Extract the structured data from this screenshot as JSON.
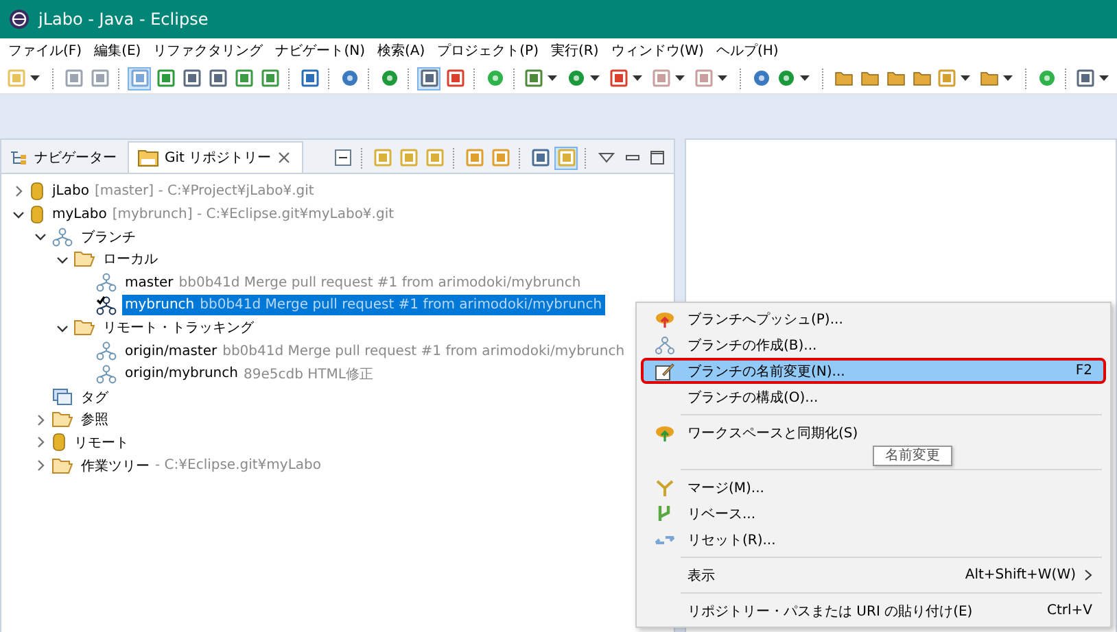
{
  "window": {
    "title": "jLabo - Java - Eclipse"
  },
  "menu_bar": [
    "ファイル(F)",
    "編集(E)",
    "リファクタリング",
    "ナビゲート(N)",
    "検索(A)",
    "プロジェクト(P)",
    "実行(R)",
    "ウィンドウ(W)",
    "ヘルプ(H)"
  ],
  "toolbar": [
    {
      "kind": "new",
      "pressed": false,
      "dropdown": true
    },
    {
      "kind": "separator"
    },
    {
      "kind": "save",
      "pressed": false,
      "dropdown": false
    },
    {
      "kind": "save",
      "pressed": false,
      "dropdown": false
    },
    {
      "kind": "separator"
    },
    {
      "kind": "link",
      "pressed": true,
      "dropdown": false
    },
    {
      "kind": "list",
      "pressed": false,
      "dropdown": false
    },
    {
      "kind": "doc",
      "pressed": false,
      "dropdown": false
    },
    {
      "kind": "doc",
      "pressed": false,
      "dropdown": false
    },
    {
      "kind": "green",
      "pressed": false,
      "dropdown": false
    },
    {
      "kind": "green",
      "pressed": false,
      "dropdown": false
    },
    {
      "kind": "separator"
    },
    {
      "kind": "monitor",
      "pressed": false,
      "dropdown": false
    },
    {
      "kind": "separator"
    },
    {
      "kind": "gear",
      "pressed": false,
      "dropdown": false
    },
    {
      "kind": "separator"
    },
    {
      "kind": "power",
      "pressed": false,
      "dropdown": false
    },
    {
      "kind": "separator"
    },
    {
      "kind": "doc",
      "pressed": true,
      "dropdown": false
    },
    {
      "kind": "red",
      "pressed": false,
      "dropdown": false
    },
    {
      "kind": "separator"
    },
    {
      "kind": "dot",
      "pressed": false,
      "dropdown": false
    },
    {
      "kind": "separator"
    },
    {
      "kind": "bug",
      "pressed": false,
      "dropdown": true
    },
    {
      "kind": "run",
      "pressed": false,
      "dropdown": true
    },
    {
      "kind": "red",
      "pressed": false,
      "dropdown": true
    },
    {
      "kind": "stop",
      "pressed": false,
      "dropdown": true
    },
    {
      "kind": "stop",
      "pressed": false,
      "dropdown": true
    },
    {
      "kind": "separator"
    },
    {
      "kind": "gear",
      "pressed": false,
      "dropdown": false
    },
    {
      "kind": "run",
      "pressed": false,
      "dropdown": true
    },
    {
      "kind": "separator"
    },
    {
      "kind": "folder",
      "pressed": false,
      "dropdown": false
    },
    {
      "kind": "folder",
      "pressed": false,
      "dropdown": false
    },
    {
      "kind": "folder",
      "pressed": false,
      "dropdown": false
    },
    {
      "kind": "folder",
      "pressed": false,
      "dropdown": false
    },
    {
      "kind": "pen",
      "pressed": false,
      "dropdown": true
    },
    {
      "kind": "folder",
      "pressed": false,
      "dropdown": true
    },
    {
      "kind": "separator"
    },
    {
      "kind": "dot",
      "pressed": false,
      "dropdown": false
    },
    {
      "kind": "separator"
    },
    {
      "kind": "doc",
      "pressed": false,
      "dropdown": true
    }
  ],
  "view": {
    "tabs": [
      {
        "label": "ナビゲーター",
        "selected": false,
        "closable": false
      },
      {
        "label": "Git リポジトリー",
        "selected": true,
        "closable": true
      }
    ],
    "toolbar": [
      {
        "kind": "collapse",
        "pressed": false
      },
      {
        "kind": "separator"
      },
      {
        "kind": "repo",
        "pressed": false
      },
      {
        "kind": "repo",
        "pressed": false
      },
      {
        "kind": "repo",
        "pressed": false
      },
      {
        "kind": "separator"
      },
      {
        "kind": "sync",
        "pressed": false
      },
      {
        "kind": "sync",
        "pressed": false
      },
      {
        "kind": "separator"
      },
      {
        "kind": "tree",
        "pressed": false
      },
      {
        "kind": "repo",
        "pressed": true
      },
      {
        "kind": "separator"
      },
      {
        "kind": "menu"
      },
      {
        "kind": "minimize"
      },
      {
        "kind": "maximize"
      }
    ]
  },
  "tree": {
    "nodes": [
      {
        "kind": "repo",
        "name": "jLabo",
        "detail": "[master] - C:¥Project¥jLabo¥.git",
        "expanded": false,
        "selected": false
      },
      {
        "kind": "repo",
        "name": "myLabo",
        "detail": "[mybrunch] - C:¥Eclipse.git¥myLabo¥.git",
        "expanded": true,
        "selected": false,
        "children": [
          {
            "kind": "branches",
            "name": "ブランチ",
            "expanded": true,
            "selected": false,
            "children": [
              {
                "kind": "folder",
                "name": "ローカル",
                "expanded": true,
                "selected": false,
                "children": [
                  {
                    "kind": "branch",
                    "name": "master",
                    "detail": "bb0b41d Merge pull request #1 from arimodoki/mybrunch",
                    "selected": false
                  },
                  {
                    "kind": "branch-checked",
                    "name": "mybrunch",
                    "detail": "bb0b41d Merge pull request #1 from arimodoki/mybrunch",
                    "selected": true
                  }
                ]
              },
              {
                "kind": "folder",
                "name": "リモート・トラッキング",
                "expanded": true,
                "selected": false,
                "children": [
                  {
                    "kind": "branch",
                    "name": "origin/master",
                    "detail": "bb0b41d Merge pull request #1 from arimodoki/mybrunch",
                    "selected": false
                  },
                  {
                    "kind": "branch",
                    "name": "origin/mybrunch",
                    "detail": "89e5cdb HTML修正",
                    "selected": false
                  }
                ]
              }
            ]
          },
          {
            "kind": "tags",
            "name": "タグ",
            "selected": false
          },
          {
            "kind": "folder",
            "name": "参照",
            "expanded": false,
            "selected": false
          },
          {
            "kind": "repo",
            "name": "リモート",
            "expanded": false,
            "selected": false
          },
          {
            "kind": "folder",
            "name": "作業ツリー",
            "detail": "- C:¥Eclipse.git¥myLabo",
            "expanded": false,
            "selected": false
          }
        ]
      }
    ]
  },
  "context_menu": {
    "items": [
      {
        "kind": "push",
        "label": "ブランチへプッシュ(P)...",
        "selected": false
      },
      {
        "kind": "create",
        "label": "ブランチの作成(B)...",
        "selected": false
      },
      {
        "kind": "rename",
        "label": "ブランチの名前変更(N)...",
        "shortcut": "F2",
        "selected": true
      },
      {
        "kind": "plain",
        "label": "ブランチの構成(O)...",
        "selected": false
      },
      {
        "kind": "separator"
      },
      {
        "kind": "sync",
        "label": "ワークスペースと同期化(S)",
        "selected": false
      },
      {
        "kind": "separator"
      },
      {
        "kind": "merge",
        "label": "マージ(M)...",
        "selected": false
      },
      {
        "kind": "rebase",
        "label": "リベース...",
        "selected": false
      },
      {
        "kind": "reset",
        "label": "リセット(R)...",
        "selected": false
      },
      {
        "kind": "separator"
      },
      {
        "kind": "plain",
        "label": "表示",
        "shortcut": "Alt+Shift+W(W)",
        "submenu": true,
        "selected": false
      },
      {
        "kind": "separator"
      },
      {
        "kind": "plain",
        "label": "リポジトリー・パスまたは URI の貼り付け(E)",
        "shortcut": "Ctrl+V",
        "selected": false
      }
    ],
    "tooltip": "名前変更"
  }
}
